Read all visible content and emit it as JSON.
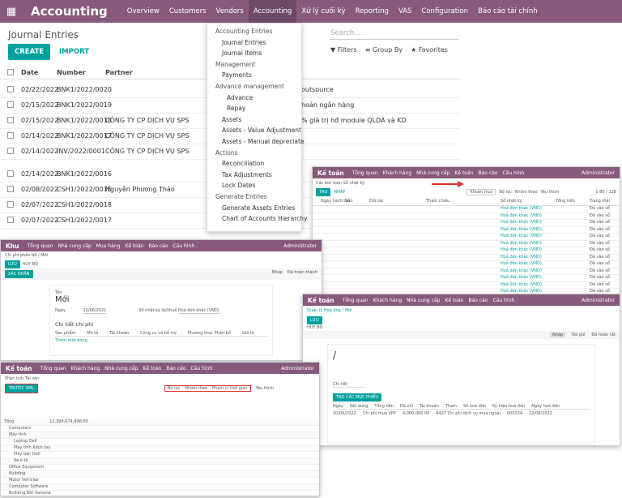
{
  "main": {
    "app": "Accounting",
    "menu": [
      "Overview",
      "Customers",
      "Vendors",
      "Accounting",
      "Xử lý cuối kỳ",
      "Reporting",
      "VAS",
      "Configuration",
      "Báo cáo tài chính"
    ],
    "title": "Journal Entries",
    "create": "CREATE",
    "import": "IMPORT",
    "search_placeholder": "Search...",
    "filters": "Filters",
    "group_by": "Group By",
    "favorites": "Favorites",
    "cols": [
      "Date",
      "Number",
      "Partner"
    ],
    "rows": [
      {
        "date": "02/22/2022",
        "num": "BNK1/2022/0020",
        "partner": "",
        "ref": "outsource"
      },
      {
        "date": "02/15/2022",
        "num": "BNK1/2022/0019",
        "partner": "",
        "ref": "hoản ngân hàng"
      },
      {
        "date": "02/15/2022",
        "num": "BNK1/2022/0018",
        "partner": "CÔNG TY CP DỊCH VỤ SPS",
        "ref": "% giá trị hđ module QLDA và KD"
      },
      {
        "date": "02/14/2022",
        "num": "BNK1/2022/0017",
        "partner": "CÔNG TY CP DỊCH VỤ SPS",
        "ref": ""
      },
      {
        "date": "02/14/2022",
        "num": "INV/2022/0001",
        "partner": "CÔNG TY CP DỊCH VỤ SPS",
        "ref": ""
      },
      {
        "date": "02/14/2022",
        "num": "BNK1/2022/0016",
        "partner": "",
        "ref": ""
      },
      {
        "date": "02/08/2022",
        "num": "CSH1/2022/0015",
        "partner": "Nguyễn Phương Thảo",
        "ref": ""
      },
      {
        "date": "02/07/2022",
        "num": "CSH1/2022/0018",
        "partner": "",
        "ref": ""
      },
      {
        "date": "02/07/2022",
        "num": "CSH1/2022/0017",
        "partner": "",
        "ref": ""
      }
    ]
  },
  "dropdown": [
    {
      "t": "Accounting Entries",
      "k": "h"
    },
    {
      "t": "Journal Entries",
      "k": "1"
    },
    {
      "t": "Journal Items",
      "k": "1"
    },
    {
      "t": "Management",
      "k": "h"
    },
    {
      "t": "Payments",
      "k": "1"
    },
    {
      "t": "Advance management",
      "k": "h"
    },
    {
      "t": "Advance",
      "k": "2"
    },
    {
      "t": "Repay",
      "k": "2"
    },
    {
      "t": "Assets",
      "k": "1"
    },
    {
      "t": "Assets - Value Adjustment",
      "k": "1"
    },
    {
      "t": "Assets - Manual depreciate",
      "k": "1"
    },
    {
      "t": "Actions",
      "k": "h"
    },
    {
      "t": "Reconciliation",
      "k": "1"
    },
    {
      "t": "Tax Adjustments",
      "k": "1"
    },
    {
      "t": "Lock Dates",
      "k": "1"
    },
    {
      "t": "Generate Entries",
      "k": "h"
    },
    {
      "t": "Generate Assets Entries",
      "k": "1"
    },
    {
      "t": "Chart of Accounts Hierarchy",
      "k": "1"
    }
  ],
  "p1": {
    "app": "Kế toán",
    "menu": [
      "Tổng quan",
      "Khách hàng",
      "Nhà cung cấp",
      "Kế toán",
      "Báo cáo",
      "Cấu hình"
    ],
    "user": "Administrator",
    "crumb": "Các bút toán Sổ nhật ký",
    "create": "TẠO",
    "import": "NHẬP",
    "filter": "Bộ lọc",
    "group": "Nhóm theo",
    "fav": "Yêu thích",
    "facet": "Khoản mục",
    "pager": "1-80 / 128",
    "cols": [
      "Ngày hạch toán",
      "Số",
      "Đối tác",
      "Tham chiếu",
      "Sổ nhật ký",
      "Tổng tiền",
      "Trạng thái"
    ],
    "journal": "Hoá đơn khác (VND)",
    "status": "Đã vào sổ"
  },
  "p2": {
    "app": "Khu",
    "menu": [
      "Tổng quan",
      "Nhà cung cấp",
      "Mua hàng",
      "Kế toán",
      "Báo cáo",
      "Cấu hình"
    ],
    "user": "Administrator",
    "crumb": "Chi phí phân bổ / Mới",
    "save": "LƯU",
    "discard": "HỦY BỎ",
    "confirm": "XÁC NHẬN",
    "draft": "Nháp",
    "done": "Đã hoàn thành",
    "status_lbl": "Tên",
    "title": "Mới",
    "date_lbl": "Ngày",
    "date": "11/06/2021",
    "journal_lbl": "Sổ nhật ký lãi/thuế",
    "journal": "Hoá đơn khác (VND)",
    "section": "Chi tiết chi phí",
    "cols": [
      "Sản phẩm",
      "Mô tả",
      "Tài khoản",
      "Công cụ và hỗ trợ",
      "Phương thức Phân bổ",
      "Giá trị"
    ],
    "add": "Thêm một dòng"
  },
  "p3": {
    "app": "Kế toán",
    "menu": [
      "Tổng quan",
      "Khách hàng",
      "Nhà cung cấp",
      "Kế toán",
      "Báo cáo",
      "Cấu hình"
    ],
    "user": "Administrator",
    "crumb": "Quản lý Hoá ứng / Mới",
    "save": "LƯU",
    "discard": "HỦY BỎ",
    "title": "/",
    "tab": "Chi tiết",
    "add_btn": "TẠO CÁC MỤC PHIẾU",
    "cols": [
      "Ngày",
      "Nội dung",
      "Tổng tiền",
      "Đã chi",
      "Tài khoản",
      "Tham",
      "Số hoá đơn",
      "Ký hiệu hoá đơn",
      "Ngày hoá đơn"
    ],
    "line": {
      "date": "20/06/2022",
      "desc": "Chi phí mua VPP",
      "amount": "4,000,000.00",
      "acc": "6427 Chi phí dịch vụ mua ngoài",
      "invno": "000234",
      "invdate": "22/06/2022"
    },
    "state_a": "Nháp",
    "state_b": "Đã gửi",
    "state_c": "Đã hoàn tất"
  },
  "p4": {
    "app": "Kế toán",
    "menu": [
      "Tổng quan",
      "Khách hàng",
      "Nhà cung cấp",
      "Kế toán",
      "Báo cáo",
      "Cấu hình"
    ],
    "user": "Administrator",
    "crumb": "Phân tích Tài sản",
    "btn": "TRƯỚC XML",
    "filter": "Bộ lọc",
    "group": "Nhóm theo",
    "period": "Phạm vi thời gian",
    "fav": "Yêu thích",
    "rows": [
      "Tổng",
      "Computers",
      "Máy tính",
      "Laptop Dell",
      "Máy tính Xách tay",
      "Máy bàn Dell",
      "Xe ô tô",
      "Office Equipment",
      "Building",
      "Motor Vehicles",
      "Computer Software",
      "Building Bắt Vanavia"
    ],
    "total": "12,399,674,998.00"
  }
}
